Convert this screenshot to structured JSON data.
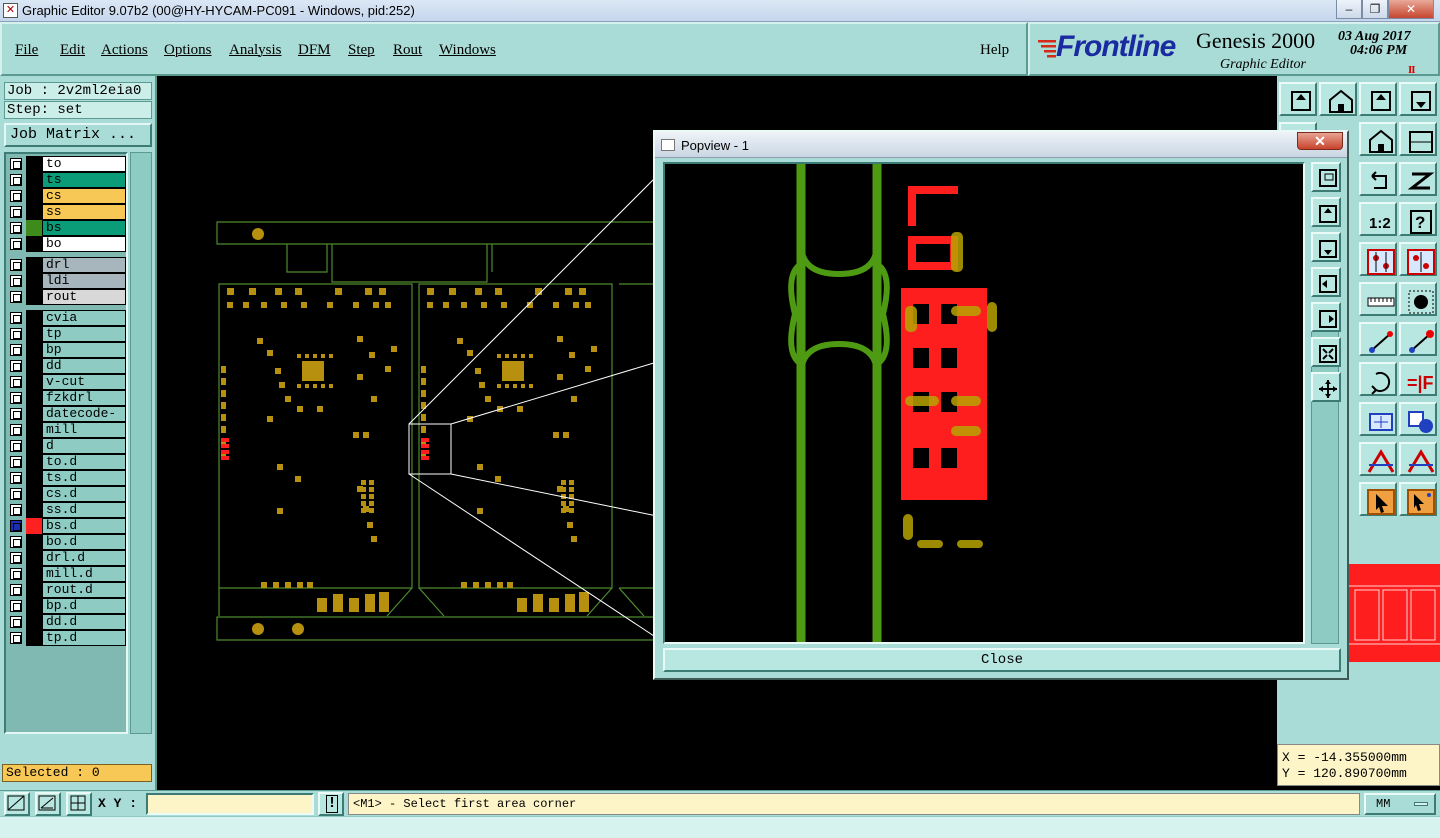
{
  "window": {
    "title": "Graphic Editor 9.07b2 (00@HY-HYCAM-PC091 - Windows, pid:252)",
    "icon": "app-icon",
    "minimize_label": "–",
    "restore_label": "❐",
    "close_label": "✕"
  },
  "menu": {
    "items": [
      {
        "label": "File",
        "key": "F"
      },
      {
        "label": "Edit",
        "key": "E"
      },
      {
        "label": "Actions",
        "key": "A"
      },
      {
        "label": "Options",
        "key": "O"
      },
      {
        "label": "Analysis",
        "key": "A"
      },
      {
        "label": "DFM",
        "key": "D"
      },
      {
        "label": "Step",
        "key": "S"
      },
      {
        "label": "Rout",
        "key": "R"
      },
      {
        "label": "Windows",
        "key": "W"
      }
    ],
    "help": "Help"
  },
  "brand": {
    "logo_text": "Frontline",
    "product": "Genesis 2000",
    "subtitle": "Graphic Editor",
    "date": "03 Aug 2017",
    "time": "04:06 PM",
    "pause_mark": "II"
  },
  "job": {
    "job_label": "Job : 2v2ml2eia0",
    "step_label": "Step: set",
    "matrix_button": "Job Matrix ..."
  },
  "layers": [
    {
      "name": "to",
      "color": "#ffffff",
      "swatch": "#000000"
    },
    {
      "name": "ts",
      "color": "#0a9b78",
      "swatch": "#000000"
    },
    {
      "name": "cs",
      "color": "#f8c857",
      "swatch": "#000000"
    },
    {
      "name": "ss",
      "color": "#f8c857",
      "swatch": "#000000"
    },
    {
      "name": "bs",
      "color": "#0a9b78",
      "swatch": "#3e8a1a"
    },
    {
      "name": "bo",
      "color": "#ffffff",
      "swatch": "#000000"
    },
    {
      "name": "drl",
      "color": "#a7b5bd",
      "swatch": "#000000",
      "gap_before": true
    },
    {
      "name": "ldi",
      "color": "#a7b5bd",
      "swatch": "#000000"
    },
    {
      "name": "rout",
      "color": "#d8d8d8",
      "swatch": "#000000"
    },
    {
      "name": "cvia",
      "color": "#8ecbc3",
      "swatch": "#000000",
      "gap_before": true
    },
    {
      "name": "tp",
      "color": "#8ecbc3",
      "swatch": "#000000"
    },
    {
      "name": "bp",
      "color": "#8ecbc3",
      "swatch": "#000000"
    },
    {
      "name": "dd",
      "color": "#8ecbc3",
      "swatch": "#000000"
    },
    {
      "name": "v-cut",
      "color": "#8ecbc3",
      "swatch": "#000000"
    },
    {
      "name": "fzkdrl",
      "color": "#8ecbc3",
      "swatch": "#000000"
    },
    {
      "name": "datecode-bs",
      "color": "#8ecbc3",
      "swatch": "#000000"
    },
    {
      "name": "mill",
      "color": "#8ecbc3",
      "swatch": "#000000"
    },
    {
      "name": "d",
      "color": "#8ecbc3",
      "swatch": "#000000"
    },
    {
      "name": "to.d",
      "color": "#8ecbc3",
      "swatch": "#000000"
    },
    {
      "name": "ts.d",
      "color": "#8ecbc3",
      "swatch": "#000000"
    },
    {
      "name": "cs.d",
      "color": "#8ecbc3",
      "swatch": "#000000"
    },
    {
      "name": "ss.d",
      "color": "#8ecbc3",
      "swatch": "#000000"
    },
    {
      "name": "bs.d",
      "color": "#8ecbc3",
      "swatch": "#ff2020",
      "cb_color": "#1a2fb0",
      "extra": "⊞"
    },
    {
      "name": "bo.d",
      "color": "#8ecbc3",
      "swatch": "#000000"
    },
    {
      "name": "drl.d",
      "color": "#8ecbc3",
      "swatch": "#000000"
    },
    {
      "name": "mill.d",
      "color": "#8ecbc3",
      "swatch": "#000000"
    },
    {
      "name": "rout.d",
      "color": "#8ecbc3",
      "swatch": "#000000"
    },
    {
      "name": "bp.d",
      "color": "#8ecbc3",
      "swatch": "#000000"
    },
    {
      "name": "dd.d",
      "color": "#8ecbc3",
      "swatch": "#000000"
    },
    {
      "name": "tp.d",
      "color": "#8ecbc3",
      "swatch": "#000000"
    }
  ],
  "selected": "Selected : 0",
  "popview": {
    "title": "Popview - 1",
    "close_x": "✕",
    "close_button": "Close",
    "tools": [
      "zoom-window-icon",
      "pan-up-icon",
      "pan-down-icon",
      "pan-left-icon",
      "pan-right-icon",
      "zoom-fit-icon",
      "zoom-home-icon"
    ]
  },
  "coords": {
    "x": "X = -14.355000mm",
    "y": "Y = 120.890700mm"
  },
  "status": {
    "xy_label": "X Y :",
    "xy_value": "",
    "info_icon": "!",
    "prompt": "<M1> - Select first area corner",
    "units": "MM"
  },
  "right_tools": [
    "pan-up-icon",
    "pan-down-icon",
    "home-icon",
    "window-icon",
    "undo-zoom-icon",
    "mirror-icon",
    "scale-1-2-icon",
    "help-icon",
    "snap-icon",
    "snap-red-icon",
    "ruler-icon",
    "dot-icon",
    "measure-icon",
    "measure-alt-icon",
    "rotate-icon",
    "flip-icon",
    "zoom-icon",
    "shapes-icon",
    "arrow-a-icon",
    "arrow-a-alt-icon",
    "select-icon",
    "select-alt-icon"
  ],
  "colors": {
    "panel": "#a9dcd6",
    "board_outline": "#4e8a2e",
    "pad": "#b89010",
    "green_trace": "#4e9a12",
    "red_copper": "#ff1e1e",
    "yellow_overlay": "#b8a400"
  }
}
